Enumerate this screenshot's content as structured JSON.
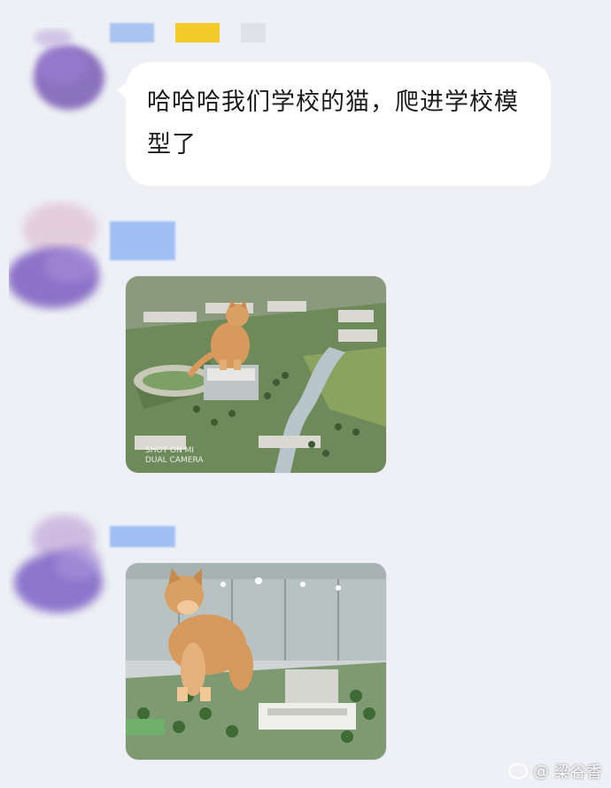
{
  "chat": {
    "messages": [
      {
        "type": "text",
        "text": "哈哈哈我们学校的猫，爬进学校模型了"
      },
      {
        "type": "image",
        "caption": "SHOT ON MI\nDUAL CAMERA",
        "icon": "campus-model-cat-photo"
      },
      {
        "type": "image",
        "caption": "",
        "icon": "campus-model-cat-photo-2"
      }
    ]
  },
  "watermark": {
    "prefix": "@",
    "handle": "梁谷香"
  },
  "colors": {
    "background": "#eef0f5",
    "bubble": "#ffffff",
    "text": "#1c1c1c"
  }
}
